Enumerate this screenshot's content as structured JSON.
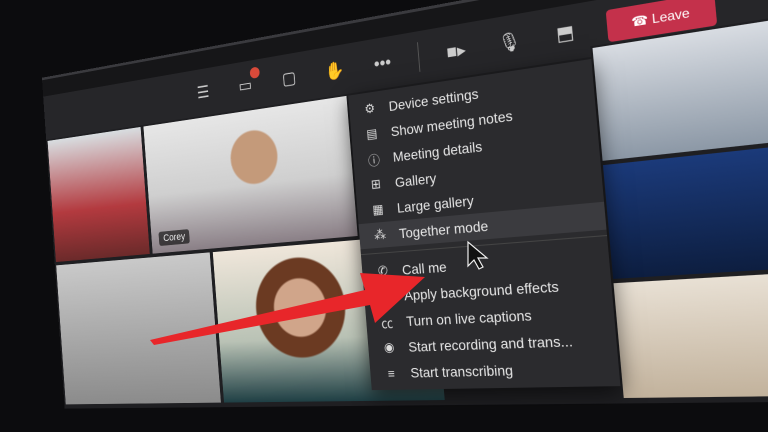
{
  "toolbar": {
    "items": [
      {
        "name": "participants",
        "icon": "list-icon"
      },
      {
        "name": "chat",
        "icon": "chat-icon",
        "badge": true
      },
      {
        "name": "reactions",
        "icon": "reaction-icon"
      },
      {
        "name": "raise-hand",
        "icon": "hand-icon"
      },
      {
        "name": "more",
        "icon": "more-icon",
        "glyph": "•••"
      },
      {
        "name": "camera",
        "icon": "camera-icon"
      },
      {
        "name": "mic",
        "icon": "mic-icon"
      },
      {
        "name": "share",
        "icon": "share-icon"
      }
    ],
    "leave_label": "Leave"
  },
  "participants": [
    {
      "name": "Corey"
    }
  ],
  "menu": {
    "items": [
      {
        "label": "Device settings",
        "icon": "gear-icon"
      },
      {
        "label": "Show meeting notes",
        "icon": "notes-icon"
      },
      {
        "label": "Meeting details",
        "icon": "info-icon"
      },
      {
        "label": "Gallery",
        "icon": "gallery-icon"
      },
      {
        "label": "Large gallery",
        "icon": "large-gallery-icon"
      },
      {
        "label": "Together mode",
        "icon": "together-mode-icon",
        "highlighted": true
      },
      {
        "label": "Call me",
        "icon": "phone-icon"
      },
      {
        "label": "Apply background effects",
        "icon": "background-effects-icon"
      },
      {
        "label": "Turn on live captions",
        "icon": "captions-icon"
      },
      {
        "label": "Start recording and trans...",
        "icon": "record-icon"
      },
      {
        "label": "Start transcribing",
        "icon": "transcribe-icon"
      }
    ]
  },
  "colors": {
    "leave": "#c4314b",
    "arrow": "#e8262a",
    "menu_bg": "#2b2b2e"
  }
}
